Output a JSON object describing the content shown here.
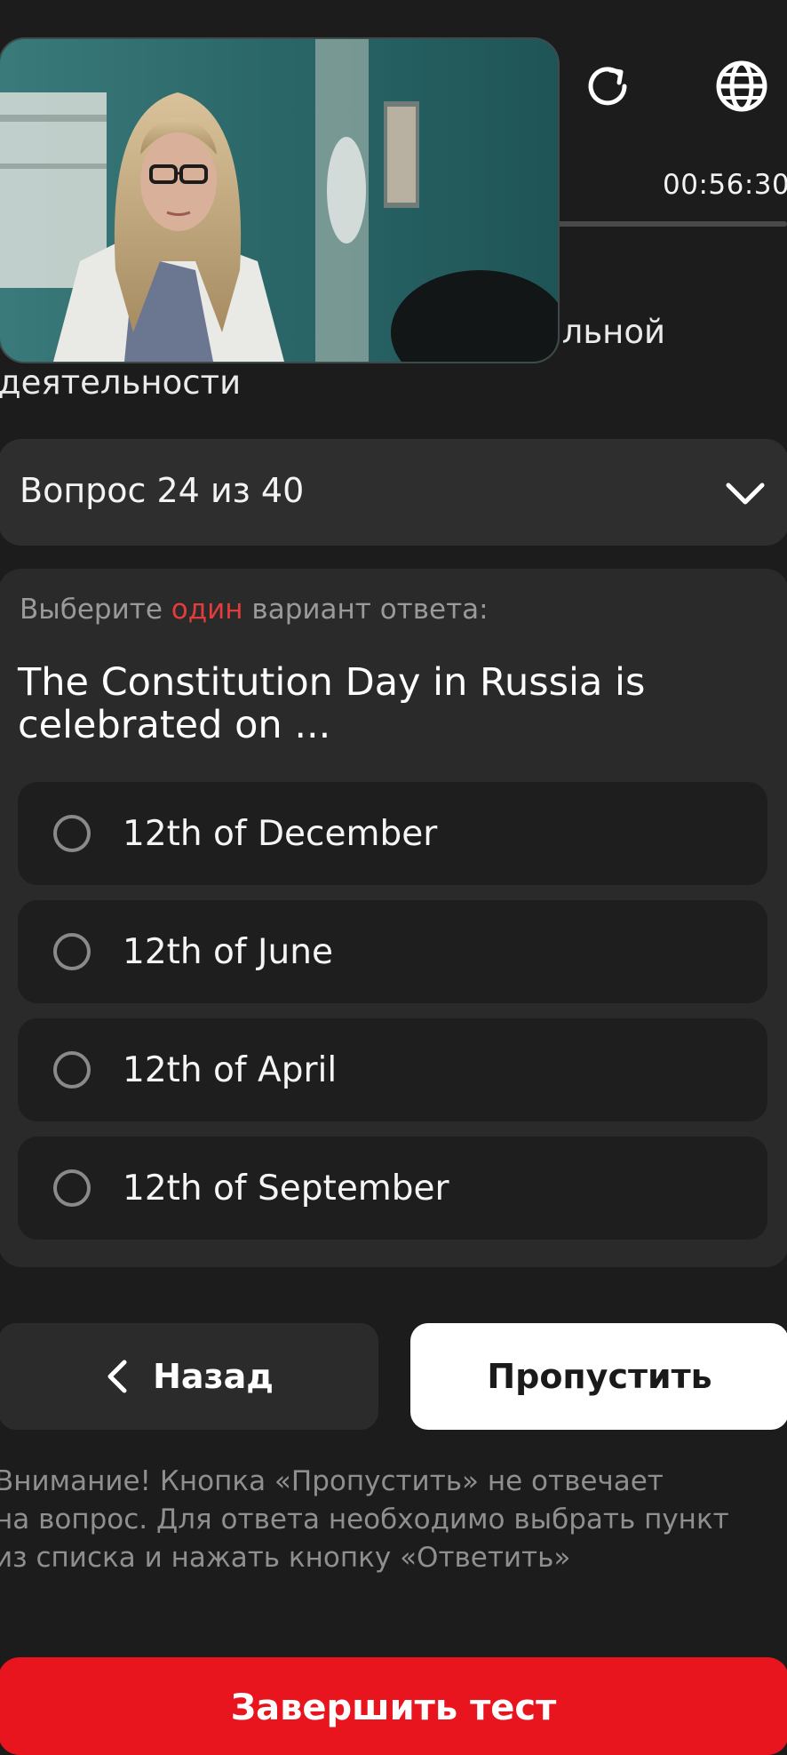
{
  "video": {
    "description_icon": "video-preview"
  },
  "header": {
    "timer": "00:56:30",
    "refresh_icon": "refresh-icon",
    "language_icon": "globe-icon"
  },
  "subject": {
    "line1_fragment": "альной",
    "line2": "деятельности"
  },
  "question_selector": {
    "label": "Вопрос 24 из 40",
    "chevron_icon": "chevron-down-icon"
  },
  "question_card": {
    "instruction_prefix": "Выберите ",
    "instruction_highlight": "один",
    "instruction_suffix": " вариант ответа:",
    "question": "The Constitution Day in Russia is celebrated on ...",
    "options": [
      {
        "label": "12th of December"
      },
      {
        "label": "12th of June"
      },
      {
        "label": "12th of April"
      },
      {
        "label": "12th of September"
      }
    ]
  },
  "nav": {
    "back_label": "Назад",
    "skip_label": "Пропустить"
  },
  "warning": {
    "line1": "Внимание! Кнопка «Пропустить» не отвечает",
    "line2": "на вопрос. Для ответа необходимо выбрать пункт",
    "line3": "из списка и нажать кнопку «Ответить»"
  },
  "finish": {
    "label": "Завершить тест"
  },
  "colors": {
    "background": "#1c1c1c",
    "card": "#2a2a2a",
    "accent_red": "#e8141e",
    "highlight_red": "#e23c3c"
  }
}
